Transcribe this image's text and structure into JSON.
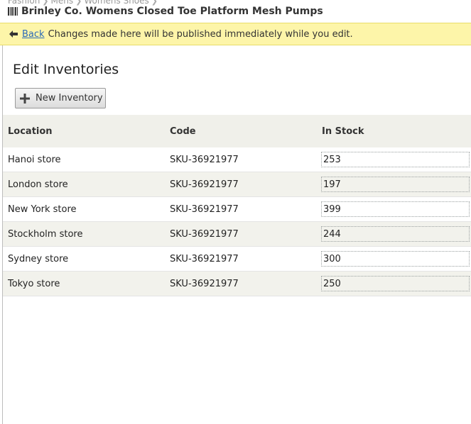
{
  "breadcrumb": [
    "Fashion",
    "Mens",
    "Womens Shoes"
  ],
  "page_title": "Brinley Co. Womens Closed Toe Platform Mesh Pumps",
  "notice": {
    "back_label": "Back",
    "message": "Changes made here will be published immediately while you edit."
  },
  "section_title": "Edit Inventories",
  "new_button_label": "New Inventory",
  "table": {
    "headers": [
      "Location",
      "Code",
      "In Stock"
    ],
    "rows": [
      {
        "location": "Hanoi store",
        "code": "SKU-36921977",
        "stock": "253"
      },
      {
        "location": "London store",
        "code": "SKU-36921977",
        "stock": "197"
      },
      {
        "location": "New York store",
        "code": "SKU-36921977",
        "stock": "399"
      },
      {
        "location": "Stockholm store",
        "code": "SKU-36921977",
        "stock": "244"
      },
      {
        "location": "Sydney store",
        "code": "SKU-36921977",
        "stock": "300"
      },
      {
        "location": "Tokyo store",
        "code": "SKU-36921977",
        "stock": "250"
      }
    ]
  },
  "icons": {
    "title": "barcode-icon",
    "back": "back-arrow-icon",
    "new": "plus-icon"
  },
  "colors": {
    "notice_bg": "#fdf5a9",
    "link": "#2a6ab8",
    "header_bg": "#f0f0ea"
  }
}
